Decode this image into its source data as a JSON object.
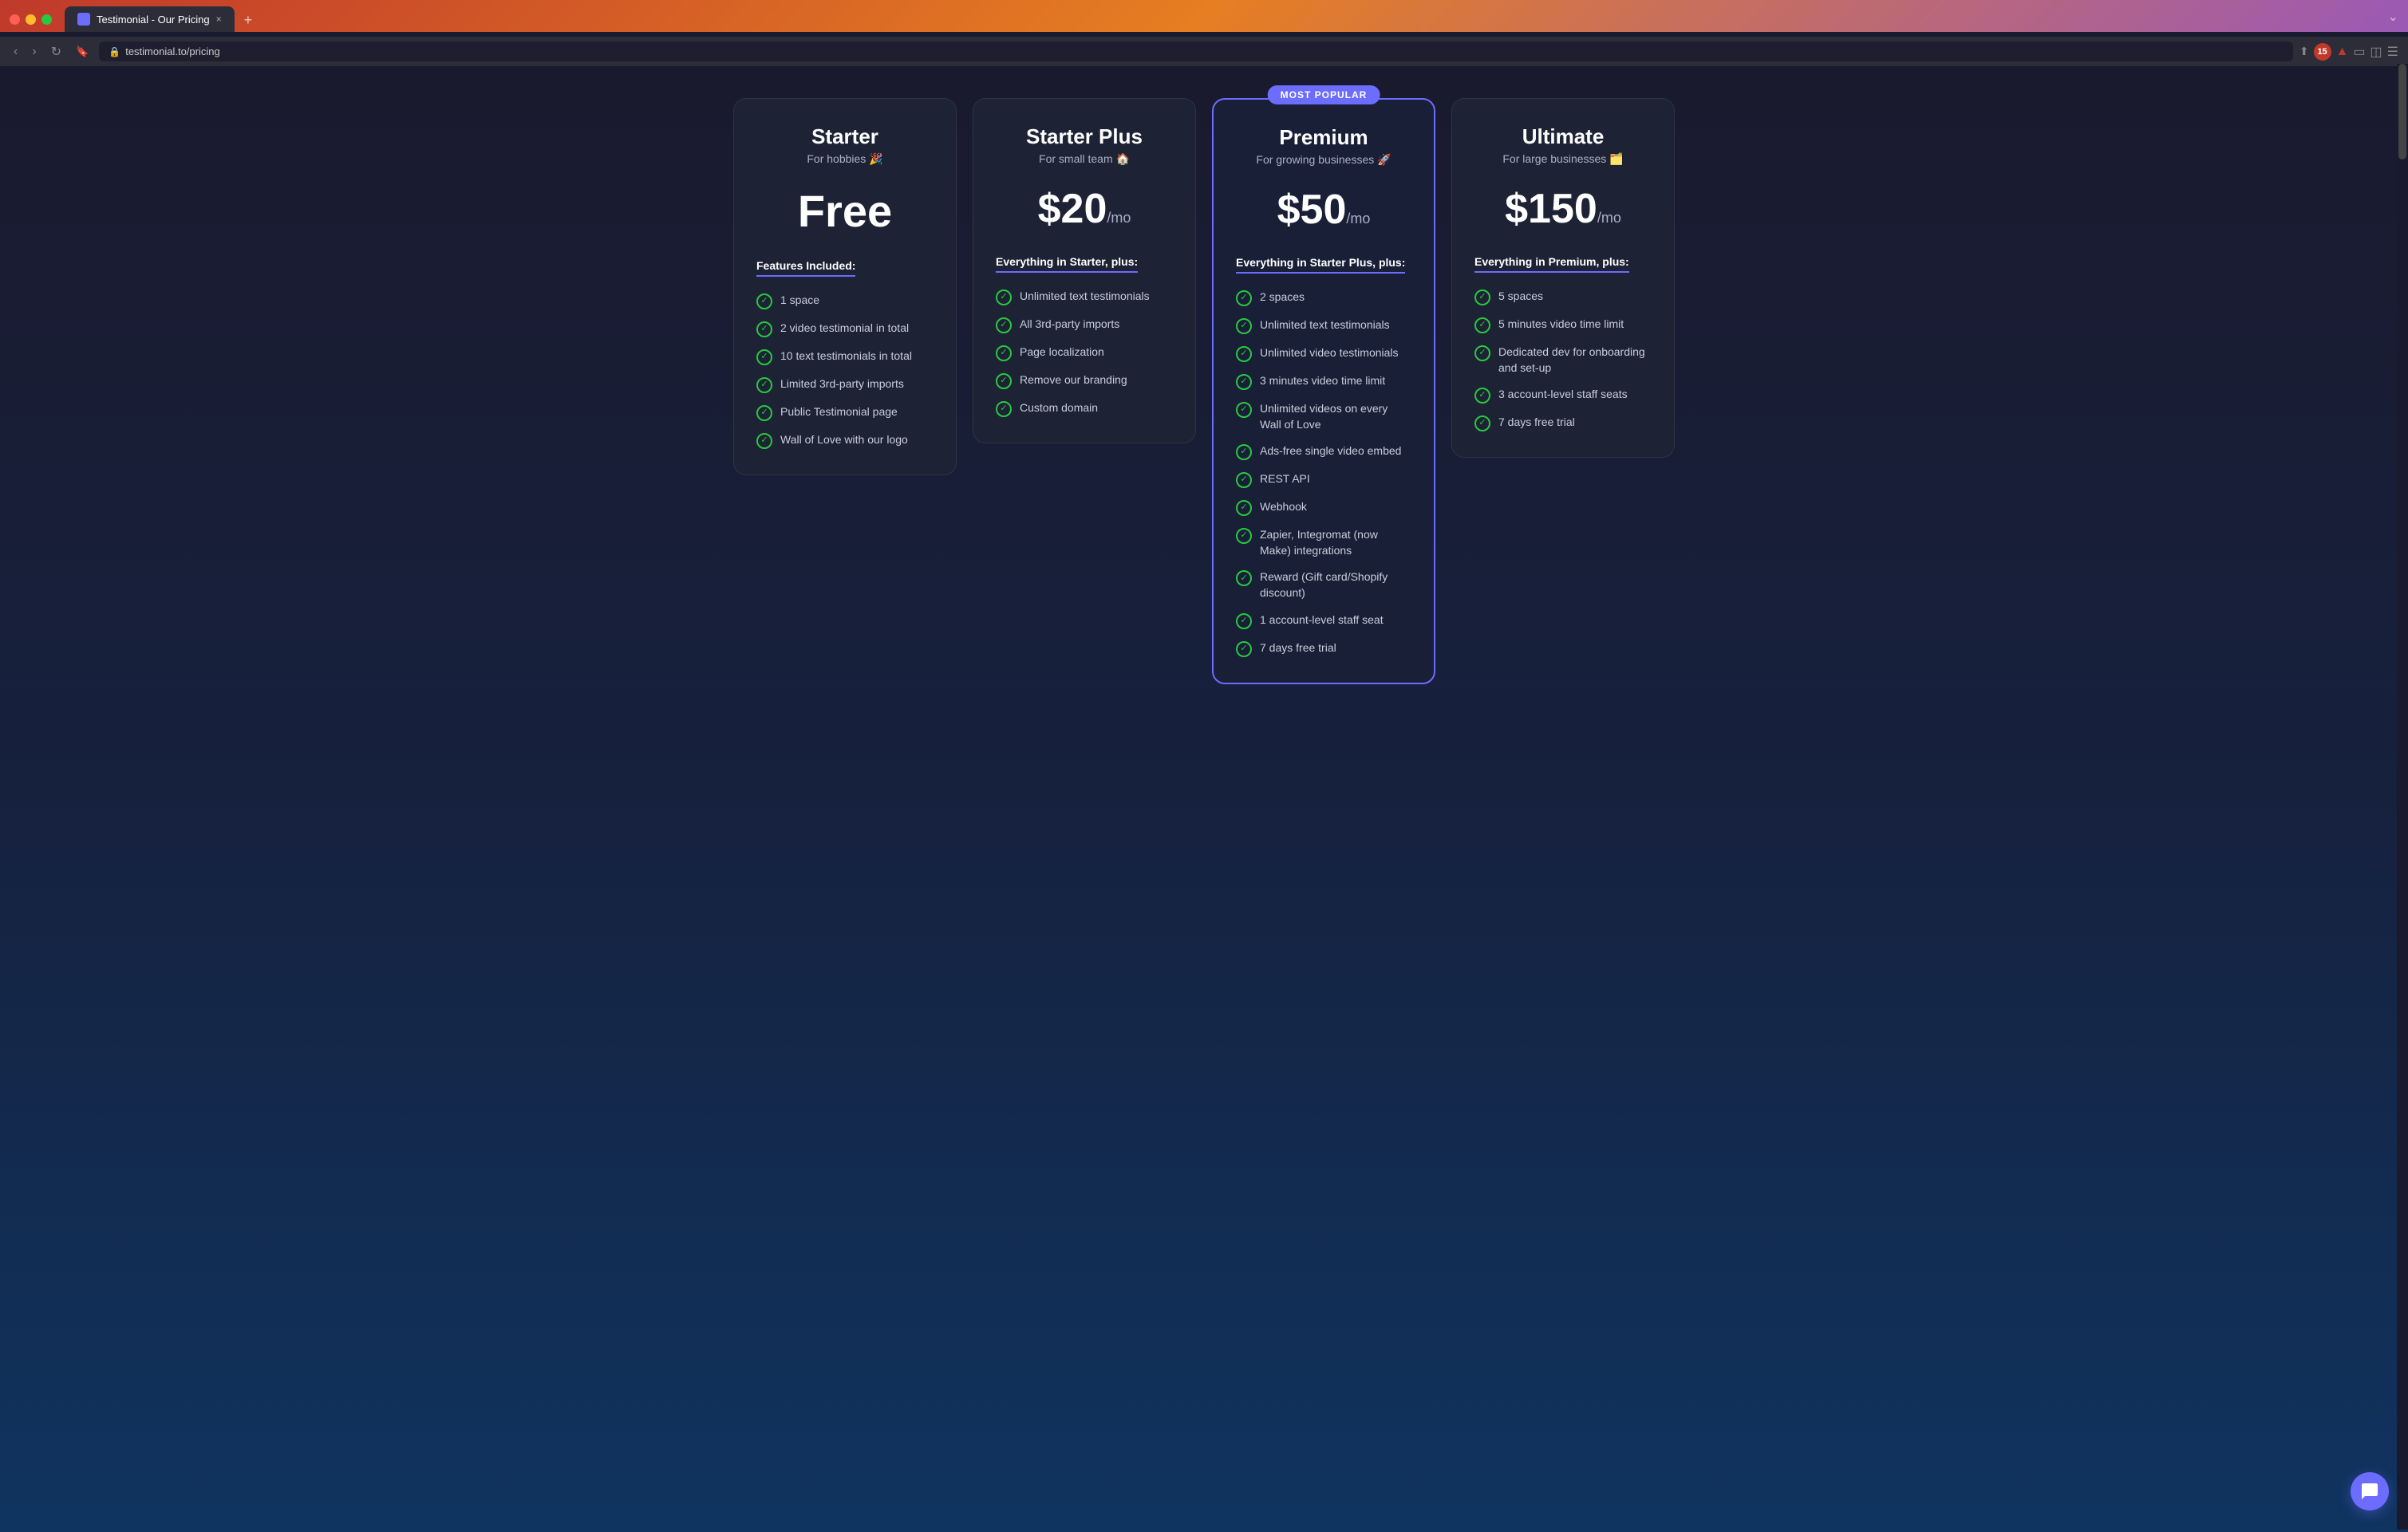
{
  "browser": {
    "title": "Testimonial - Our Pricing",
    "url": "testimonial.to/pricing",
    "url_prefix": "testimonial.to",
    "url_suffix": "/pricing",
    "tab_close": "×",
    "tab_new": "+"
  },
  "most_popular_badge": "MOST POPULAR",
  "plans": [
    {
      "id": "starter",
      "name": "Starter",
      "subtitle": "For hobbies 🎉",
      "price_display": "Free",
      "price_type": "free",
      "features_header": "Features Included:",
      "features": [
        "1 space",
        "2 video testimonial in total",
        "10 text testimonials in total",
        "Limited 3rd-party imports",
        "Public Testimonial page",
        "Wall of Love with our logo"
      ]
    },
    {
      "id": "starter-plus",
      "name": "Starter Plus",
      "subtitle": "For small team 🏠",
      "price_display": "$20",
      "price_suffix": "/mo",
      "price_type": "paid",
      "features_header": "Everything in Starter, plus:",
      "features": [
        "Unlimited text testimonials",
        "All 3rd-party imports",
        "Page localization",
        "Remove our branding",
        "Custom domain"
      ]
    },
    {
      "id": "premium",
      "name": "Premium",
      "subtitle": "For growing businesses 🚀",
      "price_display": "$50",
      "price_suffix": "/mo",
      "price_type": "paid",
      "popular": true,
      "features_header": "Everything in Starter Plus, plus:",
      "features": [
        "2 spaces",
        "Unlimited text testimonials",
        "Unlimited video testimonials",
        "3 minutes video time limit",
        "Unlimited videos on every Wall of Love",
        "Ads-free single video embed",
        "REST API",
        "Webhook",
        "Zapier, Integromat (now Make) integrations",
        "Reward (Gift card/Shopify discount)",
        "1 account-level staff seat",
        "7 days free trial"
      ]
    },
    {
      "id": "ultimate",
      "name": "Ultimate",
      "subtitle": "For large businesses 🗂️",
      "price_display": "$150",
      "price_suffix": "/mo",
      "price_type": "paid",
      "features_header": "Everything in Premium, plus:",
      "features": [
        "5 spaces",
        "5 minutes video time limit",
        "Dedicated dev for onboarding and set-up",
        "3 account-level staff seats",
        "7 days free trial"
      ]
    }
  ],
  "check_icon": "✓",
  "chat_bubble_icon": "💬"
}
